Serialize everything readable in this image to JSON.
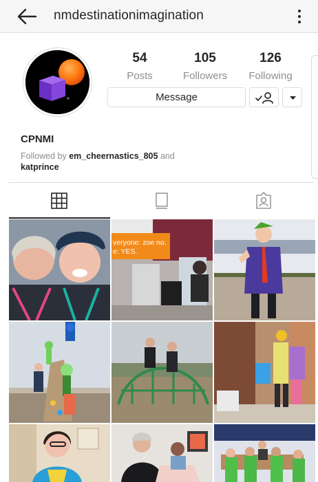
{
  "header": {
    "username": "nmdestinationimagination",
    "back_icon": "arrow-left-icon",
    "menu_icon": "more-vertical-icon"
  },
  "profile": {
    "stats": [
      {
        "value": "54",
        "label": "Posts"
      },
      {
        "value": "105",
        "label": "Followers"
      },
      {
        "value": "126",
        "label": "Following"
      }
    ],
    "message_label": "Message",
    "display_name": "CPNMI",
    "followed_by_prefix": "Followed by",
    "followed_by_user1": "em_cheernastics_805",
    "followed_by_and": "and",
    "followed_by_user2": "katprince"
  },
  "tabs": [
    {
      "icon": "grid-icon",
      "active": true
    },
    {
      "icon": "igtv-icon",
      "active": false
    },
    {
      "icon": "tagged-icon",
      "active": false
    }
  ],
  "posts": {
    "sign_text_line1": "veryone: zoe no.",
    "sign_text_line2": "e: YES."
  },
  "colors": {
    "accent_orange": "#ff7a12",
    "logo_purple": "#7b3fd0",
    "border": "#dbdbdb",
    "muted_text": "#8e8e8e"
  }
}
